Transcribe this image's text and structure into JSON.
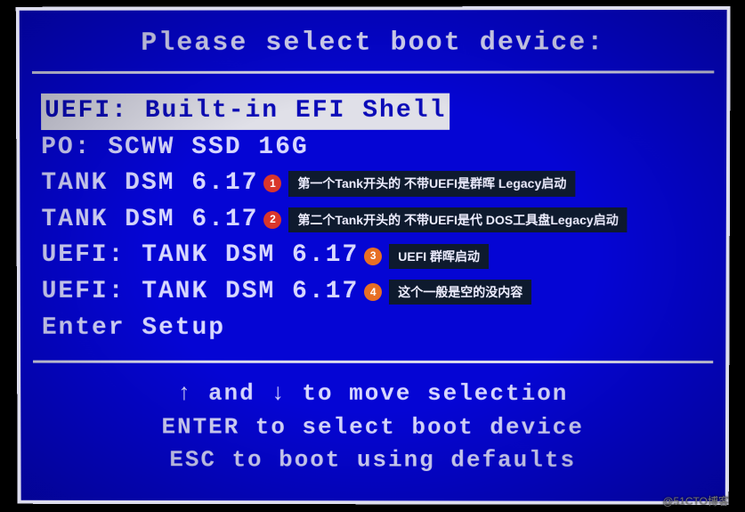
{
  "title": "Please select boot device:",
  "menu": {
    "items": [
      {
        "label": "UEFI: Built-in EFI Shell",
        "selected": true
      },
      {
        "label": "PO: SCWW SSD 16G",
        "selected": false
      },
      {
        "label": "TANK DSM 6.17",
        "selected": false
      },
      {
        "label": "TANK DSM 6.17",
        "selected": false
      },
      {
        "label": "UEFI: TANK DSM 6.17",
        "selected": false
      },
      {
        "label": "UEFI: TANK DSM 6.17",
        "selected": false
      },
      {
        "label": "Enter Setup",
        "selected": false
      }
    ]
  },
  "annotations": [
    {
      "num": "1",
      "text": "第一个Tank开头的 不带UEFI是群晖 Legacy启动",
      "color": "#d9362b"
    },
    {
      "num": "2",
      "text": "第二个Tank开头的 不带UEFI是代 DOS工具盘Legacy启动",
      "color": "#d9362b"
    },
    {
      "num": "3",
      "text": "UEFI 群晖启动",
      "color": "#e76f24"
    },
    {
      "num": "4",
      "text": "这个一般是空的没内容",
      "color": "#e76f24"
    }
  ],
  "instructions": {
    "line1_pre": "",
    "line1_mid": " and ",
    "line1_post": " to move selection",
    "line2": "ENTER to select boot device",
    "line3": "ESC to boot using defaults"
  },
  "arrows": {
    "up": "↑",
    "down": "↓"
  },
  "watermark": "@51CTO博客"
}
